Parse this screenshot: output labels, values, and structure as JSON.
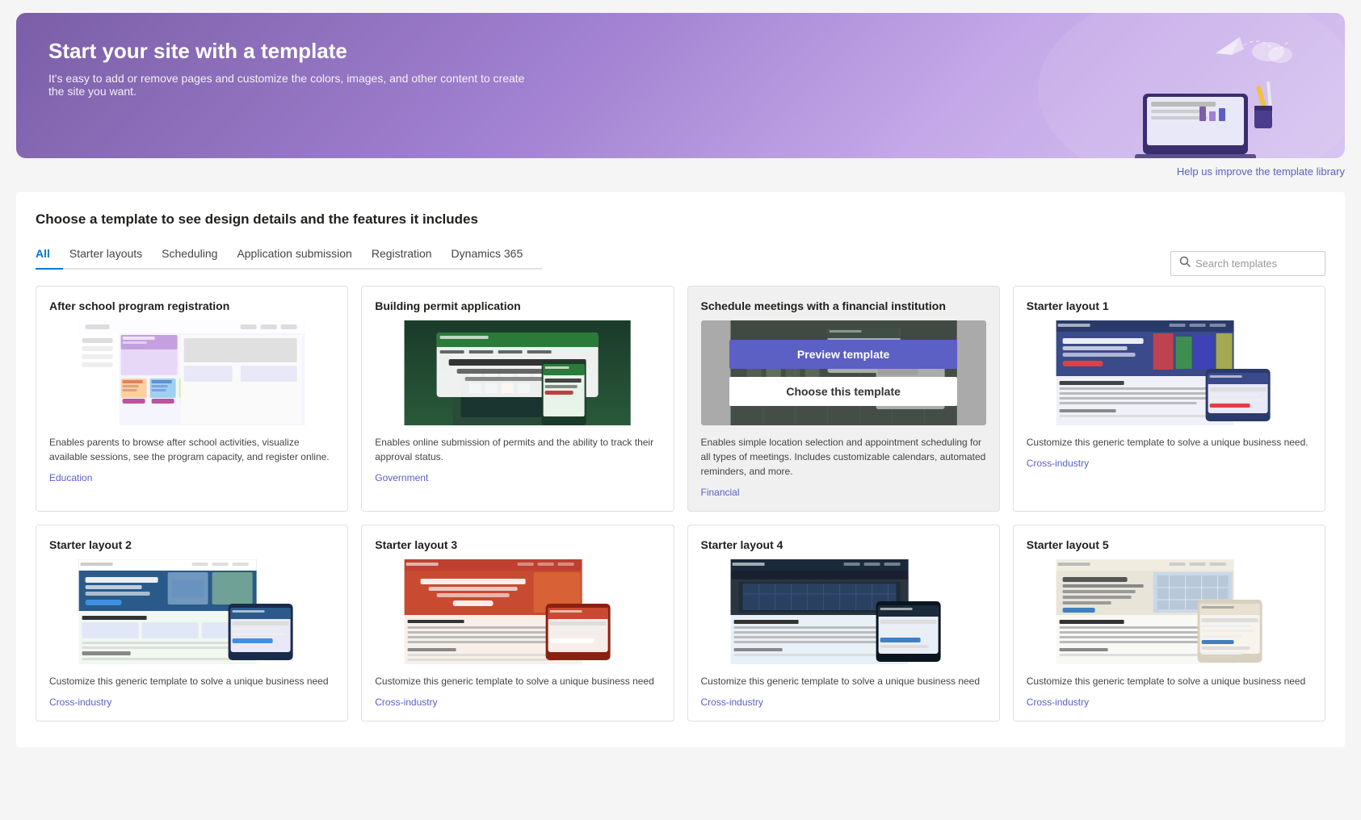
{
  "hero": {
    "title": "Start your site with a template",
    "subtitle": "It's easy to add or remove pages and customize the colors, images, and other content to create the site you want."
  },
  "help_link": "Help us improve the template library",
  "page_heading": "Choose a template to see design details and the features it includes",
  "tabs": [
    {
      "id": "all",
      "label": "All",
      "active": true
    },
    {
      "id": "starter",
      "label": "Starter layouts",
      "active": false
    },
    {
      "id": "scheduling",
      "label": "Scheduling",
      "active": false
    },
    {
      "id": "app-submission",
      "label": "Application submission",
      "active": false
    },
    {
      "id": "registration",
      "label": "Registration",
      "active": false
    },
    {
      "id": "dynamics",
      "label": "Dynamics 365",
      "active": false
    }
  ],
  "search": {
    "placeholder": "Search templates"
  },
  "cards_row1": [
    {
      "id": "after-school",
      "title": "After school program registration",
      "description": "Enables parents to browse after school activities, visualize available sessions, see the program capacity, and register online.",
      "tag": "Education",
      "thumb_style": "after-school",
      "hovered": false
    },
    {
      "id": "building-permit",
      "title": "Building permit application",
      "description": "Enables online submission of permits and the ability to track their approval status.",
      "tag": "Government",
      "thumb_style": "building-permit",
      "hovered": false
    },
    {
      "id": "schedule-meetings",
      "title": "Schedule meetings with a financial institution",
      "description": "Enables simple location selection and appointment scheduling for all types of meetings. Includes customizable calendars, automated reminders, and more.",
      "tag": "Financial",
      "thumb_style": "schedule-meetings",
      "hovered": true
    },
    {
      "id": "starter-layout-1",
      "title": "Starter layout 1",
      "description": "Customize this generic template to solve a unique business need.",
      "tag": "Cross-industry",
      "thumb_style": "starter-1",
      "hovered": false
    }
  ],
  "cards_row2": [
    {
      "id": "starter-layout-2",
      "title": "Starter layout 2",
      "description": "Customize this generic template to solve a unique business need",
      "tag": "Cross-industry",
      "thumb_style": "starter-2",
      "hovered": false
    },
    {
      "id": "starter-layout-3",
      "title": "Starter layout 3",
      "description": "Customize this generic template to solve a unique business need",
      "tag": "Cross-industry",
      "thumb_style": "starter-3",
      "hovered": false
    },
    {
      "id": "starter-layout-4",
      "title": "Starter layout 4",
      "description": "Customize this generic template to solve a unique business need",
      "tag": "Cross-industry",
      "thumb_style": "starter-4",
      "hovered": false
    },
    {
      "id": "starter-layout-5",
      "title": "Starter layout 5",
      "description": "Customize this generic template to solve a unique business need",
      "tag": "Cross-industry",
      "thumb_style": "starter-5",
      "hovered": false
    }
  ],
  "overlay": {
    "preview_label": "Preview template",
    "choose_label": "Choose this template"
  }
}
